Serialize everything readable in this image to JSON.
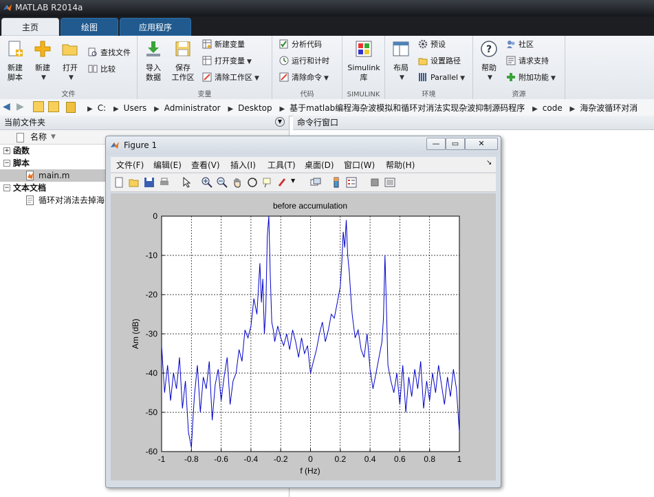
{
  "app": {
    "title": "MATLAB R2014a"
  },
  "tabs": [
    {
      "label": "主页"
    },
    {
      "label": "绘图"
    },
    {
      "label": "应用程序"
    }
  ],
  "ribbon": {
    "file_group": {
      "title": "文件",
      "new_script": "新建\n脚本",
      "new": "新建",
      "open": "打开",
      "find_files": "查找文件",
      "compare": "比较"
    },
    "variable_group": {
      "title": "变量",
      "import_data": "导入\n数据",
      "save_workspace": "保存\n工作区",
      "new_variable": "新建变量",
      "open_variable": "打开变量",
      "clear_workspace": "清除工作区"
    },
    "code_group": {
      "title": "代码",
      "analyze_code": "分析代码",
      "run_and_time": "运行和计时",
      "clear_commands": "清除命令"
    },
    "simulink_group": {
      "title": "SIMULINK",
      "library": "Simulink\n库"
    },
    "env_group": {
      "title": "环境",
      "layout": "布局",
      "preferences": "预设",
      "set_path": "设置路径",
      "parallel": "Parallel"
    },
    "resources_group": {
      "title": "资源",
      "help": "帮助",
      "community": "社区",
      "request_support": "请求支持",
      "addons": "附加功能"
    }
  },
  "address": {
    "segments": [
      "C:",
      "Users",
      "Administrator",
      "Desktop",
      "基于matlab编程海杂波模拟和循环对消法实现杂波抑制源码程序",
      "code",
      "海杂波循环对消"
    ]
  },
  "current_folder": {
    "title": "当前文件夹",
    "column_name": "名称",
    "tree": [
      {
        "label": "函数",
        "type": "group",
        "expanded": false
      },
      {
        "label": "脚本",
        "type": "group",
        "expanded": true
      },
      {
        "label": "main.m",
        "type": "file",
        "selected": true
      },
      {
        "label": "文本文档",
        "type": "group",
        "expanded": true
      },
      {
        "label": "循环对消法去掉海",
        "type": "file",
        "selected": false
      }
    ]
  },
  "command_window": {
    "title": "命令行窗口"
  },
  "figure": {
    "title": "Figure 1",
    "menu": [
      "文件(F)",
      "编辑(E)",
      "查看(V)",
      "插入(I)",
      "工具(T)",
      "桌面(D)",
      "窗口(W)",
      "帮助(H)"
    ]
  },
  "chart_data": {
    "type": "line",
    "title": "before accumulation",
    "xlabel": "f (Hz)",
    "ylabel": "Am (dB)",
    "xlim": [
      -1,
      1
    ],
    "ylim": [
      -60,
      0
    ],
    "xticks": [
      -1,
      -0.8,
      -0.6,
      -0.4,
      -0.2,
      0,
      0.2,
      0.4,
      0.6,
      0.8,
      1
    ],
    "xtick_labels": [
      "-1",
      "-0.8",
      "-0.6",
      "-0.4",
      "-0.2",
      "0",
      "0.2",
      "0.4",
      "0.6",
      "0.8",
      "1"
    ],
    "yticks": [
      -60,
      -50,
      -40,
      -30,
      -20,
      -10,
      0
    ],
    "ytick_labels": [
      "-60",
      "-50",
      "-40",
      "-30",
      "-20",
      "-10",
      "0"
    ],
    "grid": true,
    "series": [
      {
        "color": "#0000c8",
        "x": [
          -1,
          -0.98,
          -0.96,
          -0.94,
          -0.92,
          -0.9,
          -0.88,
          -0.86,
          -0.84,
          -0.82,
          -0.8,
          -0.79,
          -0.78,
          -0.76,
          -0.74,
          -0.72,
          -0.7,
          -0.68,
          -0.66,
          -0.64,
          -0.62,
          -0.6,
          -0.58,
          -0.56,
          -0.54,
          -0.52,
          -0.5,
          -0.48,
          -0.46,
          -0.44,
          -0.42,
          -0.4,
          -0.38,
          -0.36,
          -0.34,
          -0.33,
          -0.32,
          -0.31,
          -0.3,
          -0.29,
          -0.28,
          -0.27,
          -0.26,
          -0.25,
          -0.24,
          -0.22,
          -0.2,
          -0.18,
          -0.16,
          -0.14,
          -0.12,
          -0.1,
          -0.08,
          -0.06,
          -0.04,
          -0.02,
          0,
          0.02,
          0.04,
          0.06,
          0.08,
          0.1,
          0.12,
          0.14,
          0.16,
          0.18,
          0.2,
          0.21,
          0.22,
          0.23,
          0.24,
          0.25,
          0.26,
          0.27,
          0.28,
          0.3,
          0.32,
          0.34,
          0.36,
          0.38,
          0.4,
          0.42,
          0.44,
          0.46,
          0.48,
          0.49,
          0.5,
          0.51,
          0.52,
          0.54,
          0.56,
          0.58,
          0.6,
          0.62,
          0.64,
          0.66,
          0.68,
          0.7,
          0.72,
          0.74,
          0.76,
          0.78,
          0.8,
          0.82,
          0.84,
          0.86,
          0.88,
          0.9,
          0.92,
          0.94,
          0.96,
          0.98,
          1
        ],
        "y": [
          -33,
          -45,
          -38,
          -47,
          -40,
          -44,
          -36,
          -49,
          -42,
          -55,
          -59,
          -52,
          -46,
          -38,
          -50,
          -41,
          -44,
          -37,
          -52,
          -43,
          -39,
          -47,
          -41,
          -36,
          -48,
          -42,
          -40,
          -34,
          -37,
          -29,
          -31,
          -28,
          -21,
          -25,
          -12,
          -22,
          -16,
          -30,
          -24,
          -5,
          0,
          -15,
          -27,
          -29,
          -32,
          -28,
          -31,
          -33,
          -30,
          -34,
          -29,
          -32,
          -36,
          -31,
          -35,
          -33,
          -40,
          -37,
          -34,
          -30,
          -27,
          -32,
          -29,
          -25,
          -26,
          -22,
          -18,
          -12,
          -4,
          -8,
          -1,
          -10,
          -14,
          -20,
          -25,
          -31,
          -29,
          -34,
          -36,
          -30,
          -39,
          -44,
          -40,
          -36,
          -32,
          -26,
          -10,
          -23,
          -38,
          -42,
          -45,
          -40,
          -48,
          -38,
          -50,
          -41,
          -46,
          -39,
          -44,
          -37,
          -49,
          -42,
          -47,
          -40,
          -45,
          -38,
          -43,
          -48,
          -41,
          -46,
          -39,
          -44,
          -55
        ]
      }
    ]
  }
}
